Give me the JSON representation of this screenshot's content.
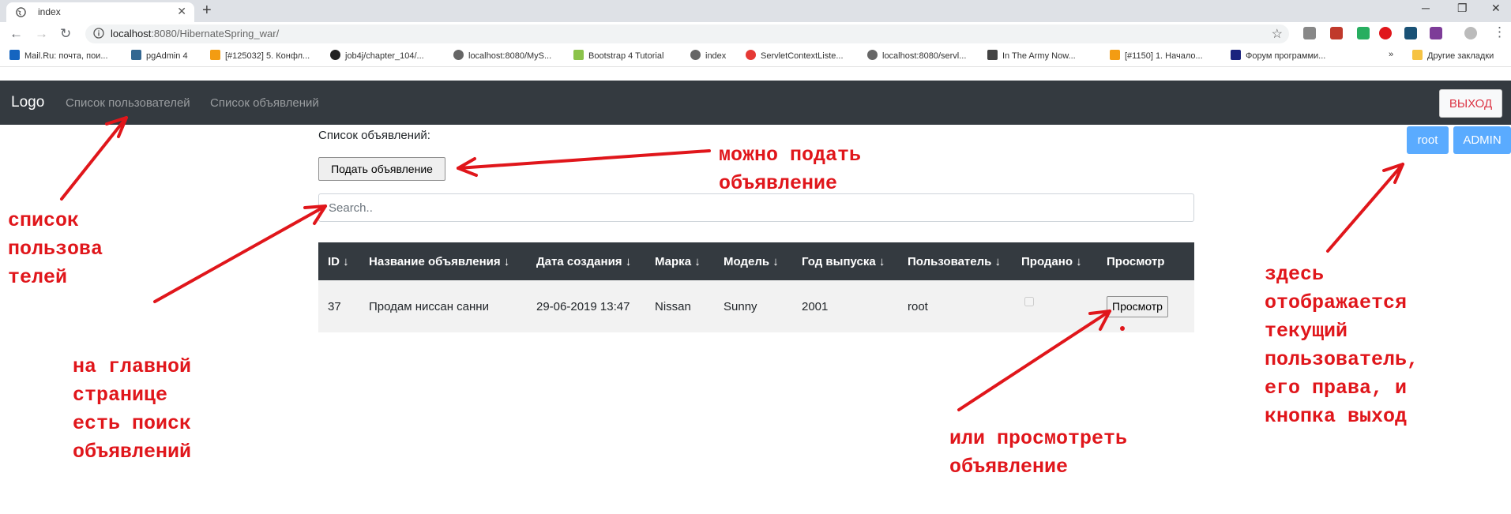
{
  "browser": {
    "tab_title": "index",
    "url_host": "localhost",
    "url_path": ":8080/HibernateSpring_war/",
    "bookmarks": [
      "Mail.Ru: почта, пои...",
      "pgAdmin 4",
      "[#125032] 5. Конфл...",
      "job4j/chapter_104/...",
      "localhost:8080/MyS...",
      "Bootstrap 4 Tutorial",
      "index",
      "ServletContextListe...",
      "localhost:8080/servl...",
      "In The Army Now...",
      "[#1150] 1. Начало...",
      "Форум программи...",
      "Другие закладки"
    ]
  },
  "navbar": {
    "brand": "Logo",
    "links": [
      "Список пользователей",
      "Список объявлений"
    ],
    "logout": "ВЫХОД",
    "user": "root",
    "role": "ADMIN"
  },
  "content": {
    "title": "Список объявлений:",
    "submit_button": "Подать объявление",
    "search_placeholder": "Search..",
    "columns": [
      "ID ↓",
      "Название объявления ↓",
      "Дата создания ↓",
      "Марка ↓",
      "Модель ↓",
      "Год выпуска ↓",
      "Пользователь ↓",
      "Продано ↓",
      "Просмотр"
    ],
    "rows": [
      {
        "id": "37",
        "name": "Продам ниссан санни",
        "created": "29-06-2019 13:47",
        "brand": "Nissan",
        "model": "Sunny",
        "year": "2001",
        "user": "root",
        "sold": false,
        "view_label": "Просмотр"
      }
    ]
  },
  "annotations": {
    "users_list": "список\nпользова\nтелей",
    "search": "на главной\nстранице\nесть поиск\nобъявлений",
    "submit": "можно подать\nобъявление",
    "view": "или просмотреть\nобъявление",
    "current_user": "здесь\nотображается\nтекущий\nпользователь,\nего права, и\nкнопка выход"
  },
  "colors": {
    "navbar": "#343a40",
    "annotation": "#e0161b",
    "badge": "#5aabff"
  }
}
